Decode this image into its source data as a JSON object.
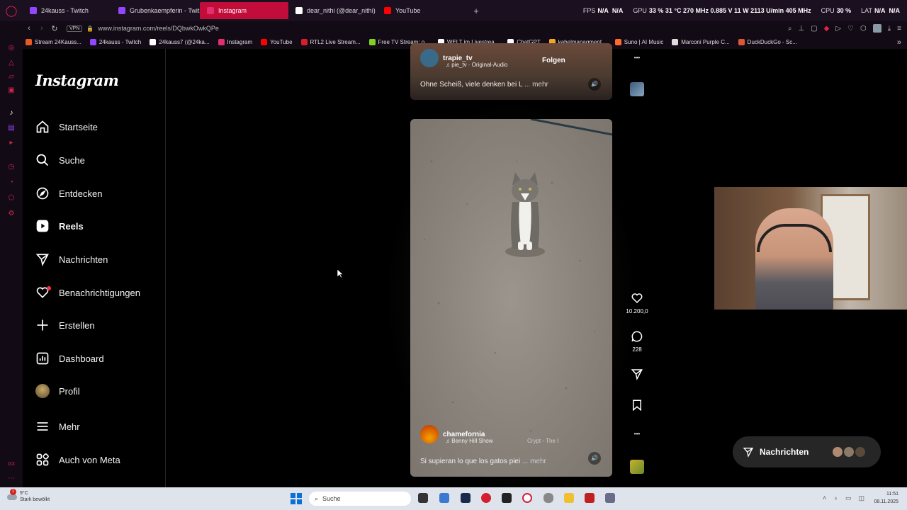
{
  "browser": {
    "tabs": [
      {
        "label": "24kauss - Twitch",
        "color": "#9146ff",
        "active": false
      },
      {
        "label": "Grubenkaempferin - Twit",
        "color": "#9146ff",
        "active": false
      },
      {
        "label": "Instagram",
        "color": "#e1306c",
        "active": true
      },
      {
        "label": "dear_nithi (@dear_nithi) |",
        "color": "#ffffff",
        "active": false
      },
      {
        "label": "YouTube",
        "color": "#ff0000",
        "active": false
      }
    ],
    "new_tab": "+",
    "hud": {
      "fps_label": "FPS",
      "fps": "N/A",
      "fps2": "N/A",
      "gpu_label": "GPU",
      "gpu_stats": "33 % 31 °C 270 MHz 0.885 V 11 W 2113 U/min 405 MHz",
      "cpu_label": "CPU",
      "cpu": "30 %",
      "lat_label": "LAT",
      "lat": "N/A",
      "lat2": "N/A"
    },
    "url": "www.instagram.com/reels/DQbwkOwkQPe",
    "vpn": "VPN",
    "bookmarks": [
      {
        "label": "Stream 24Kauss...",
        "color": "#e65c1e"
      },
      {
        "label": "24kauss - Twitch",
        "color": "#9146ff"
      },
      {
        "label": "24kauss7 (@24ka...",
        "color": "#ffffff"
      },
      {
        "label": "Instagram",
        "color": "#e1306c"
      },
      {
        "label": "YouTube",
        "color": "#ff0000"
      },
      {
        "label": "RTL2 Live Stream...",
        "color": "#d81e2a"
      },
      {
        "label": "Free TV Stream: o...",
        "color": "#7ed321"
      },
      {
        "label": "WELT im Livestrea...",
        "color": "#ffffff"
      },
      {
        "label": "ChatGPT",
        "color": "#ffffff"
      },
      {
        "label": "kabelmanagment...",
        "color": "#f5a623"
      },
      {
        "label": "Suno | AI Music",
        "color": "#ff6a2a"
      },
      {
        "label": "Marconi Purple C...",
        "color": "#dddddd"
      },
      {
        "label": "DuckDuckGo - Sc...",
        "color": "#de5833"
      }
    ]
  },
  "instagram": {
    "logo": "Instagram",
    "nav": [
      {
        "label": "Startseite",
        "icon": "home-icon"
      },
      {
        "label": "Suche",
        "icon": "search-icon"
      },
      {
        "label": "Entdecken",
        "icon": "compass-icon"
      },
      {
        "label": "Reels",
        "icon": "reels-icon"
      },
      {
        "label": "Nachrichten",
        "icon": "send-icon"
      },
      {
        "label": "Benachrichtigungen",
        "icon": "heart-icon"
      },
      {
        "label": "Erstellen",
        "icon": "plus-icon"
      },
      {
        "label": "Dashboard",
        "icon": "dashboard-icon"
      },
      {
        "label": "Profil",
        "icon": "avatar"
      },
      {
        "label": "Mehr",
        "icon": "menu-icon"
      },
      {
        "label": "Auch von Meta",
        "icon": "meta-icon"
      }
    ],
    "top_reel": {
      "username": "trapie_tv",
      "audio": "pie_tv · Original-Audio",
      "follow": "Folgen",
      "caption": "Ohne Scheiß, viele denken bei L",
      "more": "... mehr"
    },
    "main_reel": {
      "username": "chamefornia",
      "audio": "Benny Hill Show",
      "audio2": "Crypt - The I",
      "caption": "Si supieran lo que los gatos piei",
      "more": "... mehr",
      "likes": "10.200,0",
      "comments": "228"
    },
    "dm_pill": "Nachrichten"
  },
  "taskbar": {
    "weather_temp": "9°C",
    "weather_desc": "Stark bewölkt",
    "notif_count": "1",
    "search": "Suche",
    "time": "11:51",
    "date": "08.11.2025"
  }
}
